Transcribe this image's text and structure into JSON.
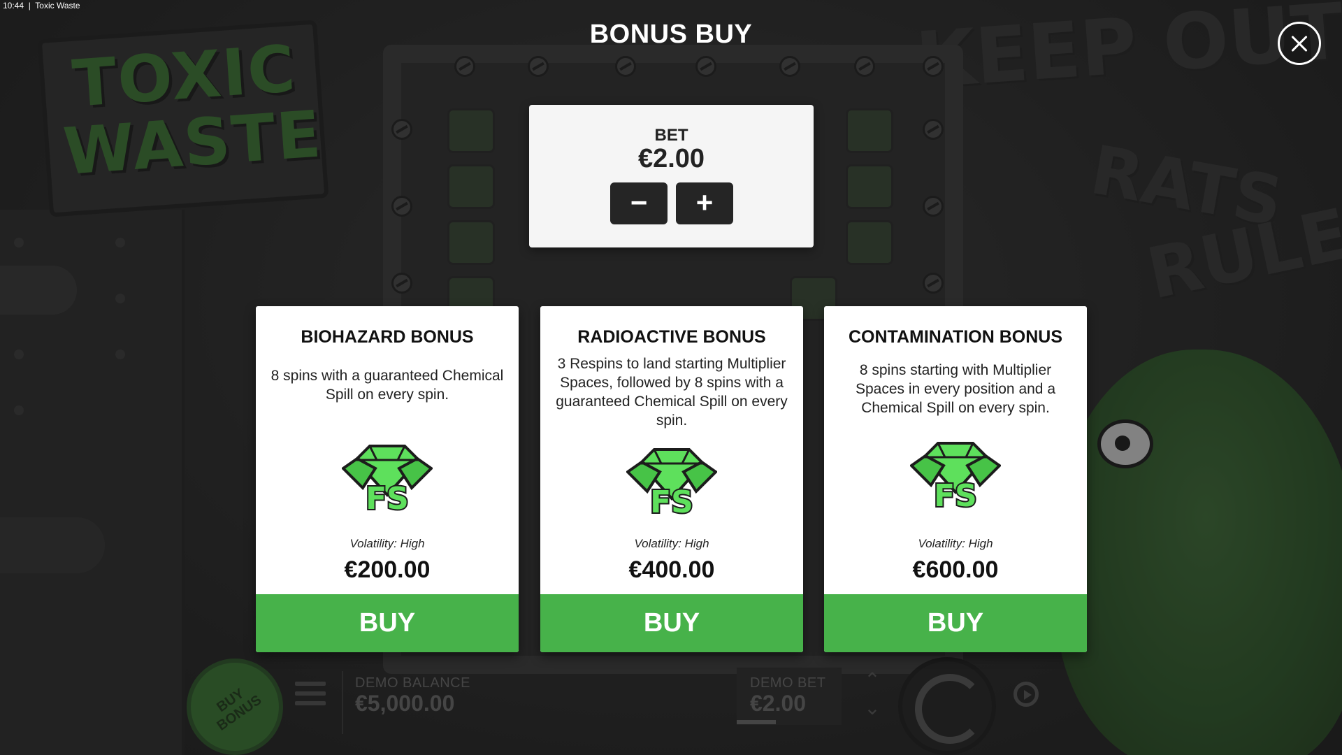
{
  "status_bar": {
    "time": "10:44",
    "app_name": "Toxic Waste"
  },
  "game": {
    "logo_line1": "TOXIC",
    "logo_line2": "WASTE",
    "graffiti": [
      "KEEP OUT!",
      "RATS",
      "RULE!"
    ],
    "buy_bonus_label": "BUY\nBONUS",
    "demo_balance_label": "DEMO BALANCE",
    "demo_balance_value": "€5,000.00",
    "demo_bet_label": "DEMO BET",
    "demo_bet_value": "€2.00"
  },
  "modal": {
    "title": "BONUS BUY",
    "bet_label": "BET",
    "bet_value": "€2.00",
    "decrease_label": "−",
    "increase_label": "+",
    "cards": [
      {
        "title": "BIOHAZARD BONUS",
        "description": "8 spins with a guaranteed Chemical Spill on every spin.",
        "icon_label": "FS",
        "volatility": "Volatility: High",
        "price": "€200.00",
        "buy_label": "BUY"
      },
      {
        "title": "RADIOACTIVE BONUS",
        "description": "3 Respins to land starting Multiplier Spaces, followed by 8 spins with a guaranteed Chemical Spill on every spin.",
        "icon_label": "FS",
        "volatility": "Volatility: High",
        "price": "€400.00",
        "buy_label": "BUY"
      },
      {
        "title": "CONTAMINATION BONUS",
        "description": "8 spins starting with Multiplier Spaces in every position and a Chemical Spill on every spin.",
        "icon_label": "FS",
        "volatility": "Volatility: High",
        "price": "€600.00",
        "buy_label": "BUY"
      }
    ]
  },
  "colors": {
    "accent_green": "#47b24a",
    "gem_green": "#5ee05c",
    "panel_bg": "#f5f5f5"
  },
  "icons": [
    "close-icon",
    "minus-icon",
    "plus-icon",
    "free-spins-gem-icon",
    "menu-icon",
    "spin-icon",
    "autoplay-icon",
    "chevron-up-icon",
    "chevron-down-icon"
  ]
}
